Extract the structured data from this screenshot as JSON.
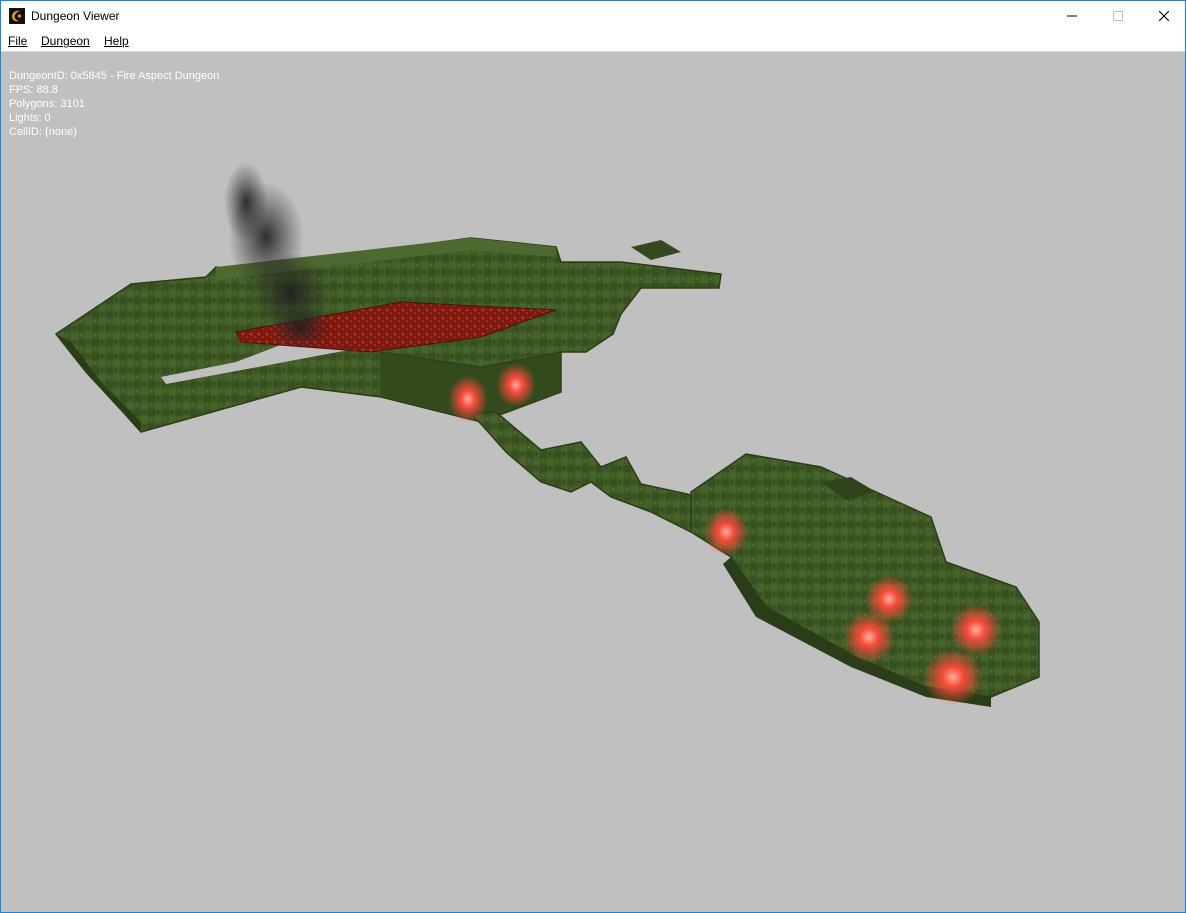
{
  "window": {
    "title": "Dungeon Viewer",
    "icon": "app-logo-icon",
    "controls": {
      "minimize": "minimize-icon",
      "maximize": "maximize-icon",
      "close": "close-icon"
    }
  },
  "menu": {
    "file": "File",
    "dungeon": "Dungeon",
    "help": "Help"
  },
  "viewport": {
    "background": "#c0c0c0",
    "hud": {
      "dungeon_id": "DungeonID: 0x5845 - Fire Aspect Dungeon",
      "fps": "FPS: 88.8",
      "polygons": "Polygons: 3101",
      "lights": "Lights: 0",
      "cell_id": "CellID: (none)"
    }
  },
  "colors": {
    "stone": "#3f5a25",
    "stone_dark": "#2a3d18",
    "lava": "#8a1e12",
    "fire_glow": "#ff4a3a",
    "smoke": "#2b2b2b",
    "accent_border": "#1883d7"
  }
}
